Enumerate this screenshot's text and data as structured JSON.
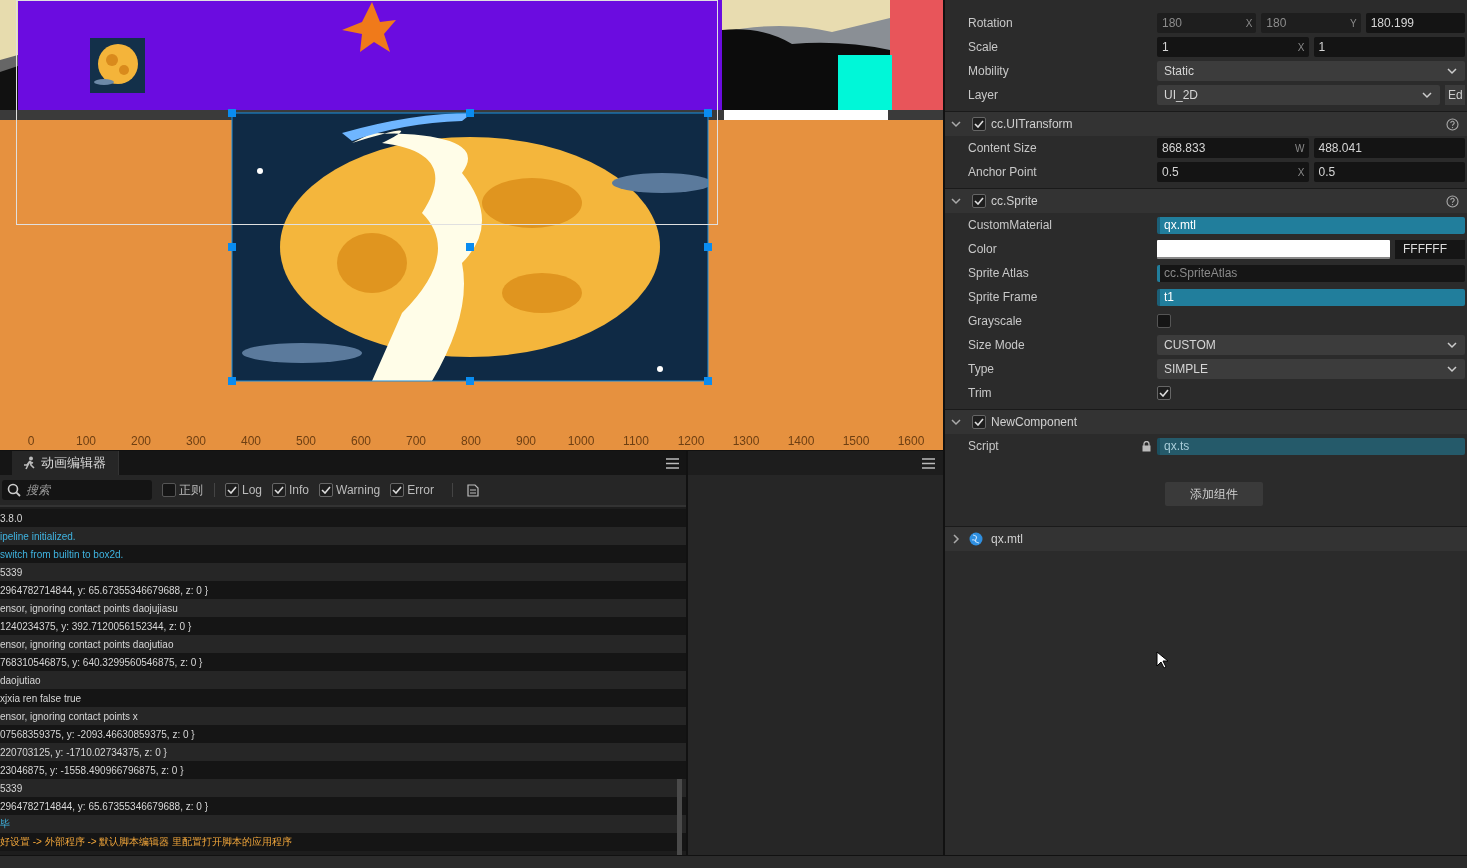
{
  "scene": {
    "ruler": [
      "0",
      "100",
      "200",
      "300",
      "400",
      "500",
      "600",
      "700",
      "800",
      "900",
      "1000",
      "1100",
      "1200",
      "1300",
      "1400",
      "1500",
      "1600"
    ]
  },
  "console": {
    "tab": {
      "label": "动画编辑器",
      "selected": true
    },
    "search": {
      "placeholder": "搜索"
    },
    "filters": [
      {
        "label": "正则",
        "checked": false
      },
      {
        "label": "Log",
        "checked": true
      },
      {
        "label": "Info",
        "checked": true
      },
      {
        "label": "Warning",
        "checked": true
      },
      {
        "label": "Error",
        "checked": true
      }
    ],
    "lines": [
      {
        "text": "3.8.0",
        "kind": "log"
      },
      {
        "text": "ipeline initialized.",
        "kind": "info"
      },
      {
        "text": "switch from builtin to box2d.",
        "kind": "info"
      },
      {
        "text": "5339",
        "kind": "log"
      },
      {
        "text": "2964782714844, y: 65.67355346679688, z: 0 }",
        "kind": "log"
      },
      {
        "text": "ensor, ignoring contact points daojujiasu",
        "kind": "log"
      },
      {
        "text": "1240234375, y: 392.7120056152344, z: 0 }",
        "kind": "log"
      },
      {
        "text": "ensor, ignoring contact points daojutiao",
        "kind": "log"
      },
      {
        "text": "768310546875, y: 640.3299560546875, z: 0 }",
        "kind": "log"
      },
      {
        "text": "daojutiao",
        "kind": "log"
      },
      {
        "text": "xjxia ren false true",
        "kind": "log"
      },
      {
        "text": "ensor, ignoring contact points x",
        "kind": "log"
      },
      {
        "text": "07568359375, y: -2093.46630859375, z: 0 }",
        "kind": "log"
      },
      {
        "text": "220703125, y: -1710.02734375, z: 0 }",
        "kind": "log"
      },
      {
        "text": "23046875, y: -1558.490966796875, z: 0 }",
        "kind": "log"
      },
      {
        "text": "5339",
        "kind": "log"
      },
      {
        "text": "2964782714844, y: 65.67355346679688, z: 0 }",
        "kind": "log"
      },
      {
        "text": "毕",
        "kind": "info"
      },
      {
        "text": "好设置 -> 外部程序 -> 默认脚本编辑器 里配置打开脚本的应用程序",
        "kind": "warning"
      }
    ]
  },
  "inspector": {
    "sections": [
      {
        "rows": [
          {
            "label": "Rotation",
            "kind": "vector",
            "values": [
              {
                "text": "180",
                "axis": "X",
                "disabled": true
              },
              {
                "text": "180",
                "axis": "Y",
                "disabled": true
              },
              {
                "text": "180.199",
                "disabled": false
              }
            ]
          },
          {
            "label": "Scale",
            "kind": "vector",
            "values": [
              {
                "text": "1",
                "axis": "X",
                "disabled": false
              },
              {
                "text": "1",
                "disabled": false
              }
            ]
          },
          {
            "label": "Mobility",
            "kind": "select",
            "value": "Static"
          },
          {
            "label": "Layer",
            "kind": "select",
            "value": "UI_2D",
            "button": "Ed"
          }
        ]
      },
      {
        "title": "cc.UITransform",
        "enabled": true,
        "expanded": true,
        "help": true,
        "rows": [
          {
            "label": "Content Size",
            "kind": "vector",
            "values": [
              {
                "text": "868.833",
                "axis": "W",
                "disabled": false
              },
              {
                "text": "488.041",
                "disabled": false
              }
            ]
          },
          {
            "label": "Anchor Point",
            "kind": "vector",
            "values": [
              {
                "text": "0.5",
                "axis": "X",
                "disabled": false
              },
              {
                "text": "0.5",
                "disabled": false
              }
            ]
          }
        ]
      },
      {
        "title": "cc.Sprite",
        "enabled": true,
        "expanded": true,
        "help": true,
        "rows": [
          {
            "label": "CustomMaterial",
            "kind": "asset",
            "value": "qx.mtl",
            "locked": false
          },
          {
            "label": "Color",
            "kind": "color",
            "color": "#ffffff",
            "value": "FFFFFF"
          },
          {
            "label": "Sprite Atlas",
            "kind": "asset",
            "placeholder": "cc.SpriteAtlas",
            "locked": false
          },
          {
            "label": "Sprite Frame",
            "kind": "asset",
            "value": "t1",
            "locked": false
          },
          {
            "label": "Grayscale",
            "kind": "checkbox",
            "checked": false
          },
          {
            "label": "Size Mode",
            "kind": "select",
            "value": "CUSTOM"
          },
          {
            "label": "Type",
            "kind": "select",
            "value": "SIMPLE"
          },
          {
            "label": "Trim",
            "kind": "checkbox",
            "checked": true
          }
        ]
      },
      {
        "title": "NewComponent",
        "enabled": true,
        "expanded": true,
        "help": false,
        "rows": [
          {
            "label": "Script",
            "kind": "asset",
            "value": "qx.ts",
            "locked": true
          }
        ]
      }
    ],
    "add_button": "添加组件",
    "material": {
      "title": "qx.mtl",
      "expanded": false
    }
  }
}
